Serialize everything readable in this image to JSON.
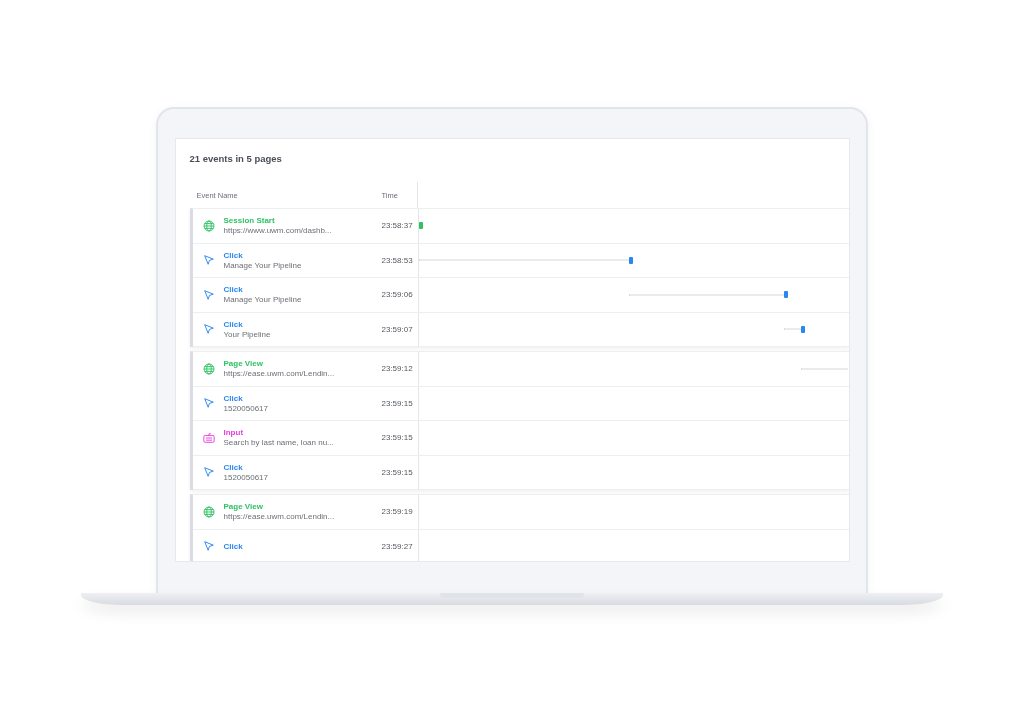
{
  "summary": "21 events in 5 pages",
  "columns": [
    "Event Name",
    "Time"
  ],
  "pages": [
    {
      "events": [
        {
          "kind": "session",
          "title": "Session Start",
          "detail": "https://www.uwm.com/dashb...",
          "time": "23:58:37",
          "level": 0
        },
        {
          "kind": "click",
          "title": "Click",
          "detail": "Manage Your Pipeline",
          "time": "23:58:53",
          "level": 0.49
        },
        {
          "kind": "click",
          "title": "Click",
          "detail": "Manage Your Pipeline",
          "time": "23:59:06",
          "level": 0.85
        },
        {
          "kind": "click",
          "title": "Click",
          "detail": "Your Pipeline",
          "time": "23:59:07",
          "level": 0.89
        }
      ]
    },
    {
      "events": [
        {
          "kind": "page",
          "title": "Page View",
          "detail": "https://ease.uwm.com/Lendin...",
          "time": "23:59:12"
        },
        {
          "kind": "click",
          "title": "Click",
          "detail": "1520050617",
          "time": "23:59:15"
        },
        {
          "kind": "input",
          "title": "Input",
          "detail": "Search by last name, loan nu...",
          "time": "23:59:15"
        },
        {
          "kind": "click",
          "title": "Click",
          "detail": "1520050617",
          "time": "23:59:15"
        }
      ]
    },
    {
      "events": [
        {
          "kind": "page",
          "title": "Page View",
          "detail": "https://ease.uwm.com/Lendin...",
          "time": "23:59:19"
        },
        {
          "kind": "click",
          "title": "Click",
          "time": "23:59:27"
        }
      ]
    }
  ]
}
